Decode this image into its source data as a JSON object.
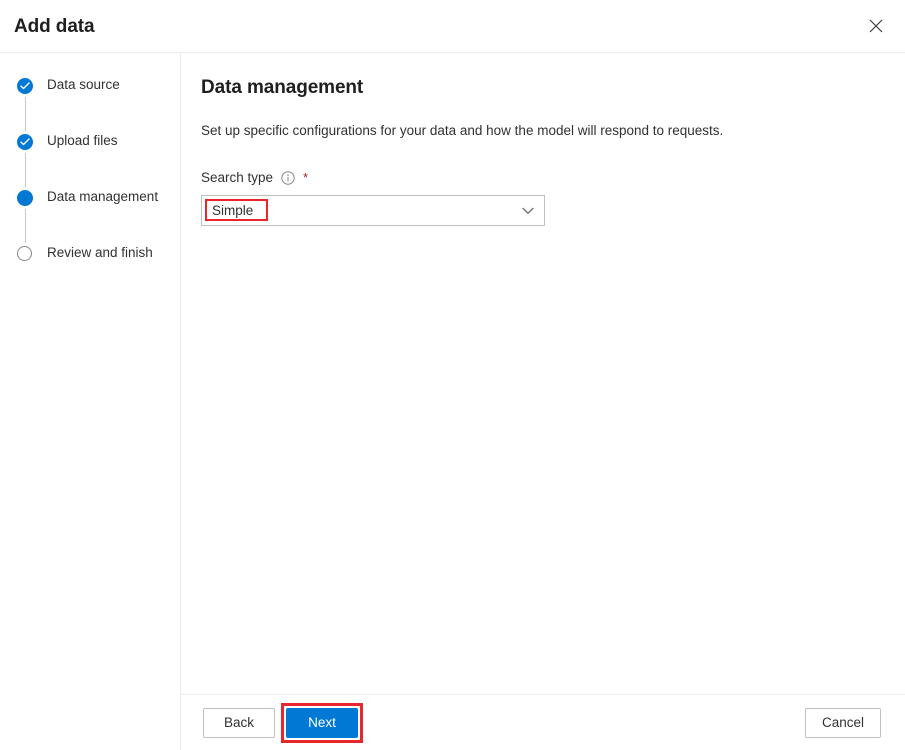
{
  "dialog": {
    "title": "Add data",
    "close_label": "Close",
    "close_icon": "close-icon"
  },
  "sidebar": {
    "steps": [
      {
        "label": "Data source",
        "state": "completed"
      },
      {
        "label": "Upload files",
        "state": "completed"
      },
      {
        "label": "Data management",
        "state": "active"
      },
      {
        "label": "Review and finish",
        "state": "pending"
      }
    ]
  },
  "content": {
    "title": "Data management",
    "description": "Set up specific configurations for your data and how the model will respond to requests.",
    "field": {
      "label": "Search type",
      "info_icon": "info-icon",
      "required_marker": "*",
      "dropdown": {
        "value": "Simple",
        "chevron_icon": "chevron-down-icon",
        "highlighted": true
      }
    }
  },
  "footer": {
    "back_label": "Back",
    "next_label": "Next",
    "cancel_label": "Cancel",
    "next_highlighted": true
  },
  "colors": {
    "accent": "#0078d4",
    "annotation": "#e8262b",
    "required": "#a4262c",
    "text": "#323130",
    "divider": "#ebebeb",
    "border": "#bfbfbf",
    "step_pending": "#8a8886"
  }
}
